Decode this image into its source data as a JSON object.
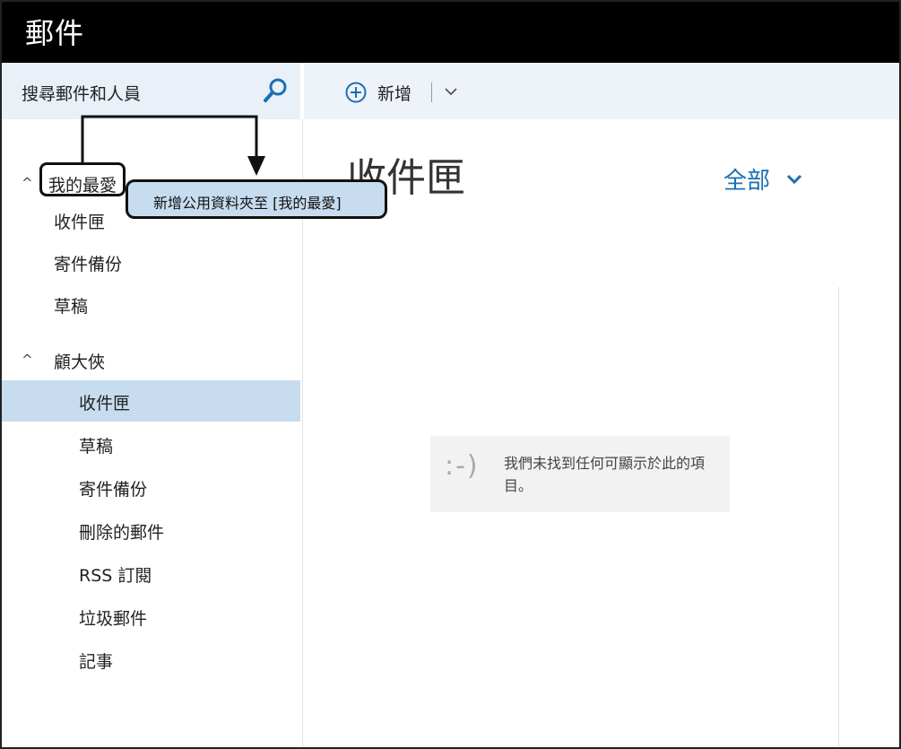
{
  "app": {
    "title": "郵件"
  },
  "search": {
    "placeholder": "搜尋郵件和人員"
  },
  "toolbar": {
    "new_label": "新增"
  },
  "sidebar": {
    "favorites": {
      "heading": "我的最愛",
      "items": [
        {
          "label": "收件匣"
        },
        {
          "label": "寄件備份"
        },
        {
          "label": "草稿"
        }
      ]
    },
    "account": {
      "heading": "顧大俠",
      "items": [
        {
          "label": "收件匣",
          "selected": true
        },
        {
          "label": "草稿"
        },
        {
          "label": "寄件備份"
        },
        {
          "label": "刪除的郵件"
        },
        {
          "label": "RSS 訂閱"
        },
        {
          "label": "垃圾郵件"
        },
        {
          "label": "記事"
        }
      ]
    }
  },
  "main": {
    "folder_title": "收件匣",
    "filter_label": "全部",
    "empty": {
      "face": ":-)",
      "message": "我們未找到任何可顯示於此的項目。"
    }
  },
  "tooltip": {
    "text": "新增公用資料夾至 [我的最愛]"
  },
  "colors": {
    "accent": "#1b6fb4",
    "selected_bg": "#c7dcef",
    "toolbar_bg": "#eef3fa",
    "topbar_bg": "#000000"
  }
}
